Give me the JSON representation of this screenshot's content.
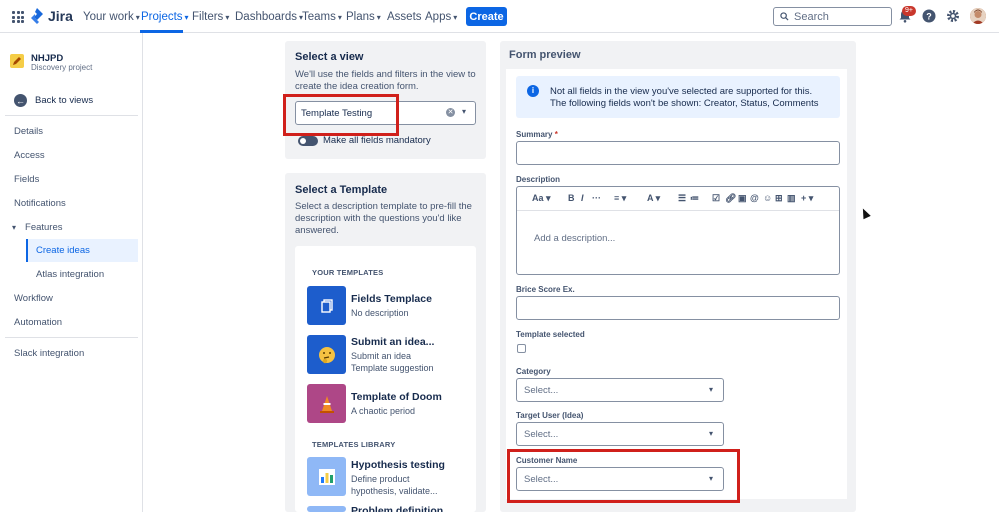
{
  "topnav": {
    "logo": "Jira",
    "items": [
      {
        "label": "Your work"
      },
      {
        "label": "Projects"
      },
      {
        "label": "Filters"
      },
      {
        "label": "Dashboards"
      },
      {
        "label": "Teams"
      },
      {
        "label": "Plans"
      },
      {
        "label": "Assets"
      },
      {
        "label": "Apps"
      }
    ],
    "active_item": "Projects",
    "create_label": "Create",
    "search_placeholder": "Search",
    "notification_badge": "9+",
    "accent_color": "#0c66e4"
  },
  "sidebar": {
    "project_name": "NHJPD",
    "project_type": "Discovery project",
    "back_label": "Back to views",
    "items": [
      {
        "label": "Details"
      },
      {
        "label": "Access"
      },
      {
        "label": "Fields"
      },
      {
        "label": "Notifications"
      },
      {
        "label": "Features"
      },
      {
        "label": "Create ideas"
      },
      {
        "label": "Atlas integration"
      },
      {
        "label": "Workflow"
      },
      {
        "label": "Automation"
      },
      {
        "label": "Slack integration"
      }
    ],
    "active_item": "Create ideas"
  },
  "select_view": {
    "title": "Select a view",
    "description_line1": "We'll use the fields and filters in the view to",
    "description_line2": "create the idea creation form.",
    "selected_value": "Template Testing",
    "toggle_label": "Make all fields mandatory"
  },
  "select_template": {
    "title": "Select a Template",
    "description_line1": "Select a description template to pre-fill the",
    "description_line2": "description with the questions you'd like",
    "description_line3": "answered.",
    "your_templates_heading": "YOUR TEMPLATES",
    "your_templates": [
      {
        "name": "Fields Templace",
        "line1": "No description",
        "line2": "",
        "icon": "document-icon"
      },
      {
        "name": "Submit an idea...",
        "line1": "Submit an idea",
        "line2": "Template suggestion",
        "icon": "thinking-face-icon"
      },
      {
        "name": "Template of Doom",
        "line1": "A chaotic period",
        "line2": "",
        "icon": "fire-cone-icon"
      }
    ],
    "library_heading": "TEMPLATES LIBRARY",
    "library": [
      {
        "name": "Hypothesis testing",
        "line1": "Define product",
        "line2": "hypothesis, validate...",
        "icon": "chart-icon"
      },
      {
        "name": "Problem definition",
        "line1": "",
        "line2": "",
        "icon": "problem-icon"
      }
    ]
  },
  "form_preview": {
    "title": "Form preview",
    "info_line1": "Not all fields in the view you've selected are supported for this.",
    "info_line2": "The following fields won't be shown: Creator, Status, Comments",
    "summary_label": "Summary",
    "required_mark": "*",
    "description_label": "Description",
    "description_placeholder": "Add a description...",
    "toolbar_text_style": "Aa",
    "brice_label": "Brice Score Ex.",
    "template_selected_label": "Template selected",
    "category_label": "Category",
    "category_placeholder": "Select...",
    "target_user_label": "Target User (Idea)",
    "target_user_placeholder": "Select...",
    "customer_name_label": "Customer Name",
    "customer_name_placeholder": "Select..."
  },
  "highlight_color": "#d0201b"
}
